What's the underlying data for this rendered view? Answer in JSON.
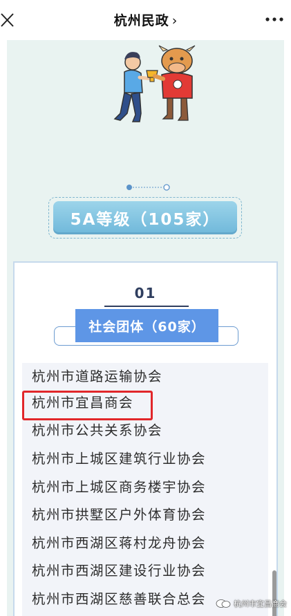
{
  "navbar": {
    "title": "杭州民政",
    "chevron": "›"
  },
  "article": {
    "level_title": "5A等级（105家）",
    "section": {
      "number": "01",
      "category": "社会团体（60家）",
      "items": [
        "杭州市道路运输协会",
        "杭州市宜昌商会",
        "杭州市公共关系协会",
        "杭州市上城区建筑行业协会",
        "杭州市上城区商务楼宇协会",
        "杭州市拱墅区户外体育协会",
        "杭州市西湖区蒋村龙舟协会",
        "杭州市西湖区建设行业协会",
        "杭州市西湖区慈善联合总会"
      ],
      "highlighted_item": "杭州市宜昌商会"
    }
  },
  "watermark": {
    "text": "杭州市宜昌商会"
  },
  "colors": {
    "article_bg": "#e9f3f1",
    "level_pill": "#7fc3e2",
    "category_tag": "#5e96e6",
    "highlight": "#e1262a"
  },
  "icons": [
    "close-icon",
    "more-icon",
    "chevron-right-icon",
    "wechat-watermark-icon"
  ]
}
